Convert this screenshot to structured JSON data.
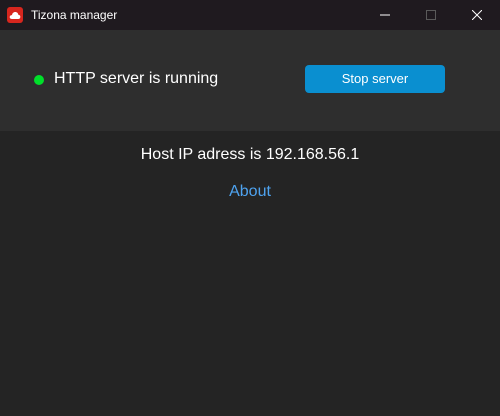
{
  "window": {
    "title": "Tizona manager",
    "icon": "cloud-icon"
  },
  "controls": {
    "minimize_icon": "minimize-icon",
    "maximize_icon": "maximize-icon",
    "close_icon": "close-icon"
  },
  "status": {
    "text": "HTTP server is running",
    "indicator_color": "#00e02a",
    "stop_label": "Stop server"
  },
  "info": {
    "host_ip": "Host IP adress is 192.168.56.1",
    "about_label": "About"
  },
  "colors": {
    "accent": "#0a8fd0",
    "link": "#4ea3f0",
    "brand": "#d7261e"
  }
}
